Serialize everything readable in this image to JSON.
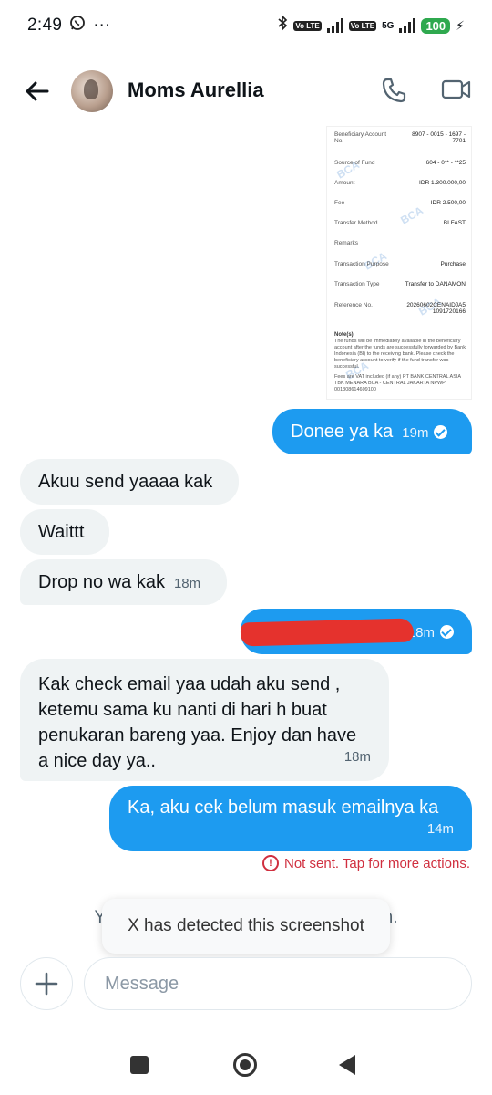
{
  "status_bar": {
    "time": "2:49",
    "menu_dots": "···",
    "volte_label": "Vo LTE",
    "network": "5G",
    "battery": "100"
  },
  "header": {
    "contact_name": "Moms Aurellia"
  },
  "receipt": {
    "watermark": "BCA",
    "rows": [
      {
        "label": "Beneficiary Account No.",
        "value": "8907 - 0015 - 1697 - 7701"
      },
      {
        "label": "Source of Fund",
        "value": "604 - 0** - **25"
      },
      {
        "label": "Amount",
        "value": "IDR 1.300.000,00"
      },
      {
        "label": "Fee",
        "value": "IDR 2.500,00"
      },
      {
        "label": "Transfer Method",
        "value": "BI FAST"
      },
      {
        "label": "Remarks",
        "value": ""
      },
      {
        "label": "Transaction Purpose",
        "value": "Purchase"
      },
      {
        "label": "Transaction Type",
        "value": "Transfer to DANAMON"
      },
      {
        "label": "Reference No.",
        "value": "20260602CENAIDJA5 1091720166"
      }
    ],
    "notes_title": "Note(s)",
    "notes_1": "The funds will be immediately available in the beneficiary account after the funds are successfully forwarded by Bank Indonesia (BI) to the receiving bank. Please check the beneficiary account to verify if the fund transfer was successful.",
    "notes_2": "Fees are VAT included (if any) PT BANK CENTRAL ASIA TBK MENARA BCA - CENTRAL JAKARTA NPWP: 001308614609100"
  },
  "messages": [
    {
      "direction": "out",
      "text": "Donee ya ka",
      "time": "19m"
    },
    {
      "direction": "in",
      "text": "Akuu send yaaaa kak",
      "time": ""
    },
    {
      "direction": "in",
      "text": "Waittt",
      "time": ""
    },
    {
      "direction": "in",
      "text": "Drop no wa kak",
      "time": "18m"
    },
    {
      "direction": "out",
      "text": "",
      "time": "18m"
    },
    {
      "direction": "in",
      "text": "Kak check email yaa udah aku send , ketemu sama ku nanti di hari h buat penukaran bareng yaa. Enjoy dan have a nice day ya..",
      "time": "18m"
    },
    {
      "direction": "out",
      "text": "Ka, aku cek belum masuk emailnya ka",
      "time": "14m"
    }
  ],
  "error_text": "Not sent. Tap for more actions.",
  "info_line": "You a                                              rson.",
  "toast": "X has detected this screenshot",
  "composer": {
    "placeholder": "Message"
  }
}
